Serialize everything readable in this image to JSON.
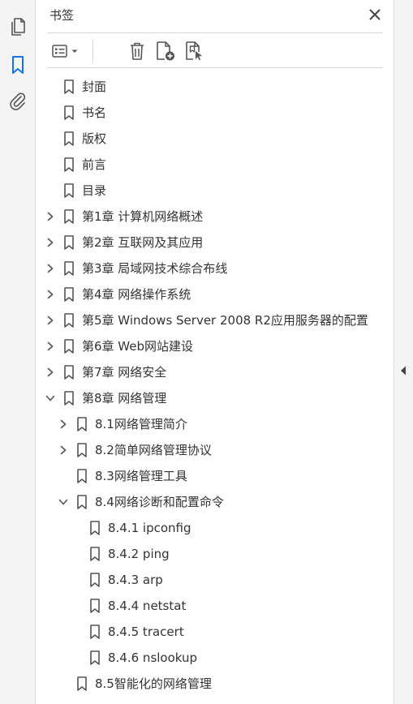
{
  "panel": {
    "title": "书签"
  },
  "icons": {
    "left_rail": [
      "pages-icon",
      "bookmark-icon",
      "attachment-icon"
    ],
    "toolbar": [
      "bookmark-options-icon",
      "chevron-down-icon",
      "delete-icon",
      "new-bookmark-icon",
      "new-bookmark-from-structure-icon"
    ],
    "close": "close-icon",
    "collapse": "collapse-arrow-icon"
  },
  "colors": {
    "accent": "#1473e6",
    "text": "#333333",
    "icon": "#555555"
  },
  "bookmarks": [
    {
      "label": "封面",
      "level": 0,
      "expander": "none"
    },
    {
      "label": "书名",
      "level": 0,
      "expander": "none"
    },
    {
      "label": "版权",
      "level": 0,
      "expander": "none"
    },
    {
      "label": "前言",
      "level": 0,
      "expander": "none"
    },
    {
      "label": "目录",
      "level": 0,
      "expander": "none"
    },
    {
      "label": "第1章  计算机网络概述",
      "level": 0,
      "expander": "collapsed"
    },
    {
      "label": "第2章  互联网及其应用",
      "level": 0,
      "expander": "collapsed"
    },
    {
      "label": "第3章  局域网技术综合布线",
      "level": 0,
      "expander": "collapsed"
    },
    {
      "label": "第4章  网络操作系统",
      "level": 0,
      "expander": "collapsed"
    },
    {
      "label": "第5章  Windows Server 2008 R2应用服务器的配置",
      "level": 0,
      "expander": "collapsed"
    },
    {
      "label": "第6章  Web网站建设",
      "level": 0,
      "expander": "collapsed"
    },
    {
      "label": "第7章  网络安全",
      "level": 0,
      "expander": "collapsed"
    },
    {
      "label": "第8章  网络管理",
      "level": 0,
      "expander": "expanded"
    },
    {
      "label": "8.1网络管理简介",
      "level": 1,
      "expander": "collapsed"
    },
    {
      "label": "8.2简单网络管理协议",
      "level": 1,
      "expander": "collapsed"
    },
    {
      "label": "8.3网络管理工具",
      "level": 1,
      "expander": "none"
    },
    {
      "label": "8.4网络诊断和配置命令",
      "level": 1,
      "expander": "expanded"
    },
    {
      "label": "8.4.1  ipconfig",
      "level": 2,
      "expander": "none"
    },
    {
      "label": "8.4.2  ping",
      "level": 2,
      "expander": "none"
    },
    {
      "label": "8.4.3  arp",
      "level": 2,
      "expander": "none"
    },
    {
      "label": "8.4.4  netstat",
      "level": 2,
      "expander": "none"
    },
    {
      "label": "8.4.5 tracert",
      "level": 2,
      "expander": "none"
    },
    {
      "label": "8.4.6  nslookup",
      "level": 2,
      "expander": "none"
    },
    {
      "label": "8.5智能化的网络管理",
      "level": 1,
      "expander": "none"
    }
  ]
}
